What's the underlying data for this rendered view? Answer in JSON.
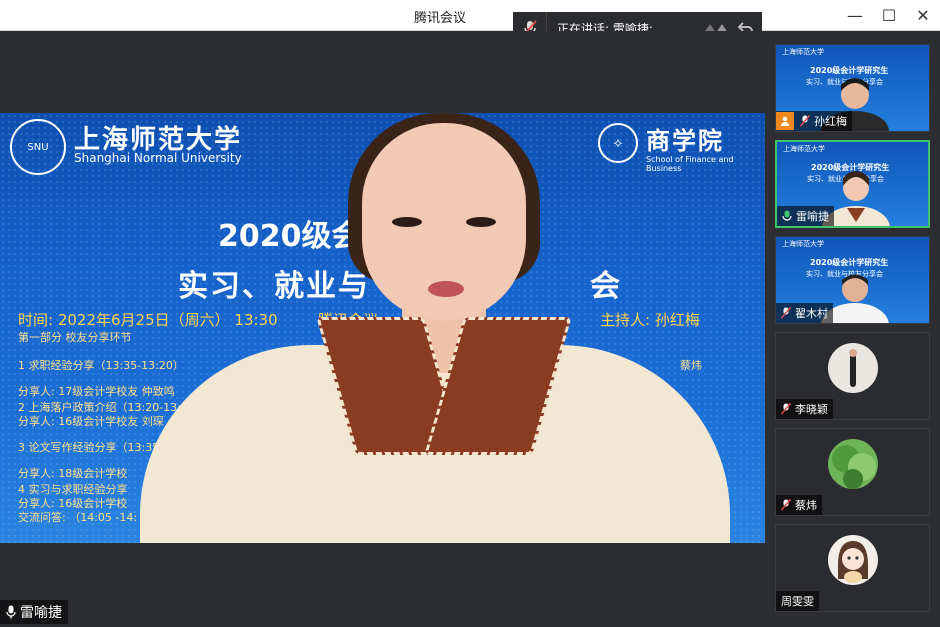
{
  "window": {
    "title": "腾讯会议",
    "minimize_glyph": "—",
    "maximize_glyph": "☐",
    "close_glyph": "✕"
  },
  "speaking": {
    "label": "正在讲话: 雷喻捷;"
  },
  "slide": {
    "university_cn": "上海师范大学",
    "university_en": "Shanghai Normal University",
    "school_cn": "商学院",
    "school_en": "School of Finance and Business",
    "title_line1": "2020级会",
    "title_line2": "实习、就业与",
    "title_line2_tail": "会",
    "time_line": "时间: 2022年6月25日（周六）  13:30",
    "venue": "腾讯会议",
    "host": "主持人: 孙红梅",
    "lines": [
      "第一部分  校友分享环节",
      "1    求职经验分享（13:35-13:20）",
      "   分享人: 17级会计学校友  仲致鸣",
      "2 上海落户政策介绍（13:20-13:35）",
      "   分享人: 16级会计学校友  刘琛",
      "3  论文写作经验分享（13:35-",
      "   分享人: 18级会计学校",
      "4  实习与求职经验分享",
      "   分享人: 16级会计学校",
      "交流问答: （14:05 -14:"
    ],
    "right_name": "蔡炜"
  },
  "main_speaker": {
    "name": "雷喻捷"
  },
  "participants": [
    {
      "name": "孙红梅",
      "type": "video",
      "host": true
    },
    {
      "name": "雷喻捷",
      "type": "video",
      "active": true
    },
    {
      "name": "翟木村",
      "type": "video"
    },
    {
      "name": "李晓颖",
      "type": "avatar"
    },
    {
      "name": "蔡炜",
      "type": "avatar"
    },
    {
      "name": "周雯雯",
      "type": "avatar"
    }
  ],
  "thumb_slide": {
    "title": "2020级会计学研究生",
    "subtitle": "实习、就业与校友分享会"
  },
  "colors": {
    "active_border": "#3fc36f",
    "host_badge": "#f08a1e",
    "slide_blue": "#1561c9",
    "slide_text_yellow": "#ffe08a"
  }
}
